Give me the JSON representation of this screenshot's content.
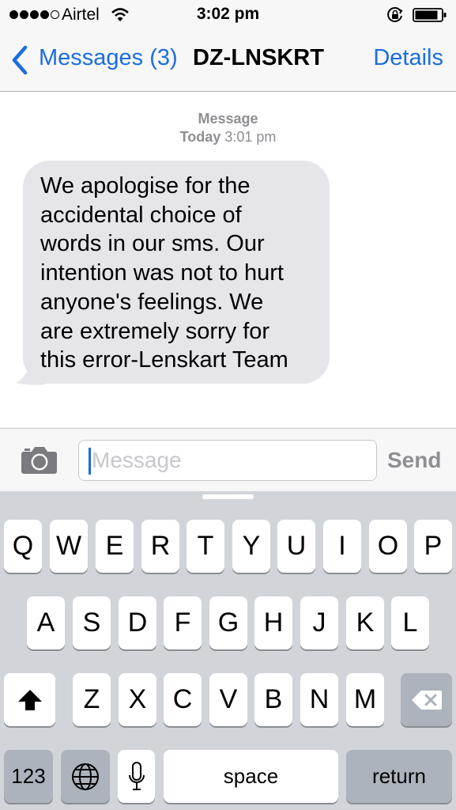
{
  "status_bar": {
    "carrier": "Airtel",
    "time": "3:02 pm",
    "signal_dots_filled": 4,
    "signal_dots_total": 5,
    "icons": [
      "wifi-icon",
      "rotation-lock-icon",
      "battery-icon"
    ]
  },
  "nav": {
    "back_label": "Messages (3)",
    "title": "DZ-LNSKRT",
    "details_label": "Details"
  },
  "conversation": {
    "timestamp_label": "Message",
    "timestamp_day": "Today",
    "timestamp_time": "3:01 pm",
    "messages": [
      {
        "direction": "incoming",
        "lines": [
          "We apologise for the",
          "accidental choice of",
          "words in our sms. Our",
          "intention was not to hurt",
          "anyone's feelings. We",
          "are extremely sorry for",
          "this error-Lenskart Team"
        ]
      }
    ]
  },
  "input_bar": {
    "placeholder": "Message",
    "send_label": "Send"
  },
  "keyboard": {
    "row1": [
      "Q",
      "W",
      "E",
      "R",
      "T",
      "Y",
      "U",
      "I",
      "O",
      "P"
    ],
    "row2": [
      "A",
      "S",
      "D",
      "F",
      "G",
      "H",
      "J",
      "K",
      "L"
    ],
    "row3": [
      "Z",
      "X",
      "C",
      "V",
      "B",
      "N",
      "M"
    ],
    "numbers_label": "123",
    "space_label": "space",
    "return_label": "return"
  },
  "colors": {
    "accent": "#1a6dde",
    "bubble_incoming": "#e5e5ea",
    "keyboard_bg": "#d1d4d9",
    "key_dark": "#acb3bc"
  }
}
